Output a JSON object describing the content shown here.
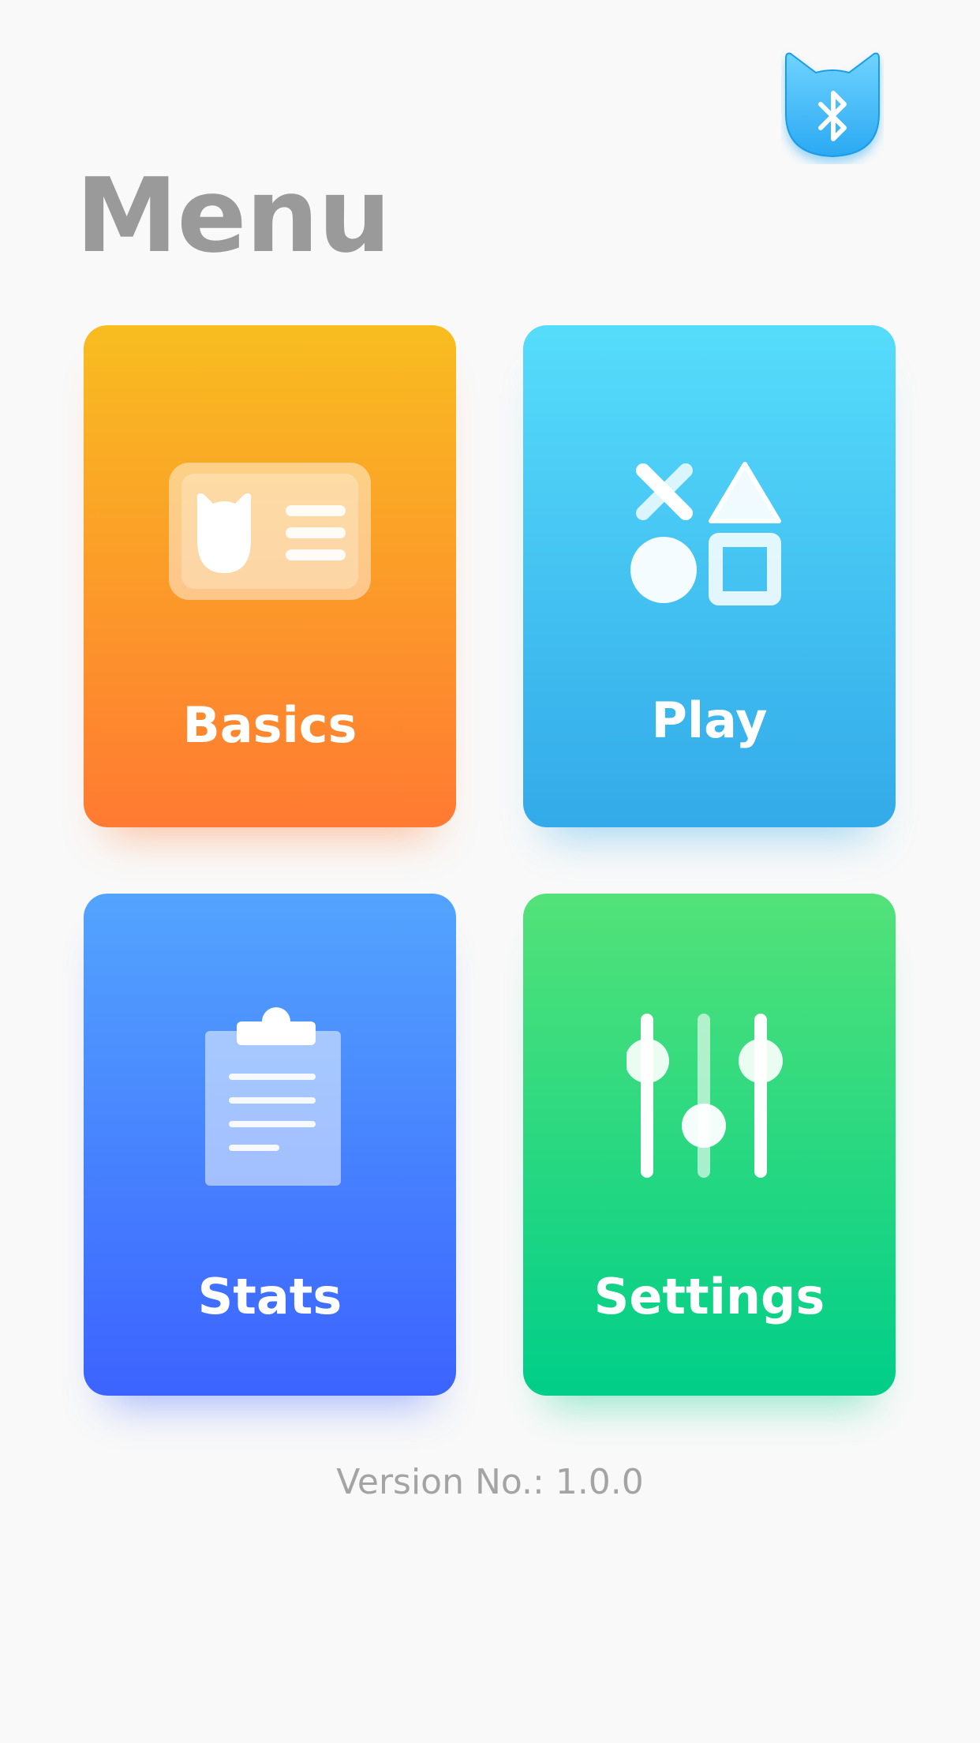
{
  "header": {
    "title": "Menu",
    "bluetooth_icon": "bluetooth-cat-icon"
  },
  "menu": {
    "tiles": [
      {
        "id": "basics",
        "label": "Basics",
        "icon": "cat-id-card-icon",
        "gradient": [
          "#f8bd20",
          "#ff7a32"
        ]
      },
      {
        "id": "play",
        "label": "Play",
        "icon": "game-shapes-icon",
        "gradient": [
          "#56dcfb",
          "#33aae9"
        ]
      },
      {
        "id": "stats",
        "label": "Stats",
        "icon": "clipboard-icon",
        "gradient": [
          "#53a4fe",
          "#3c63ff"
        ]
      },
      {
        "id": "settings",
        "label": "Settings",
        "icon": "sliders-icon",
        "gradient": [
          "#53e279",
          "#00ce89"
        ]
      }
    ]
  },
  "footer": {
    "version": "Version No.: 1.0.0"
  },
  "colors": {
    "background": "#f9f9f9",
    "title": "#9a9a9a",
    "version_text": "#a4a4a4",
    "bluetooth_button": "#3fb7f5"
  }
}
